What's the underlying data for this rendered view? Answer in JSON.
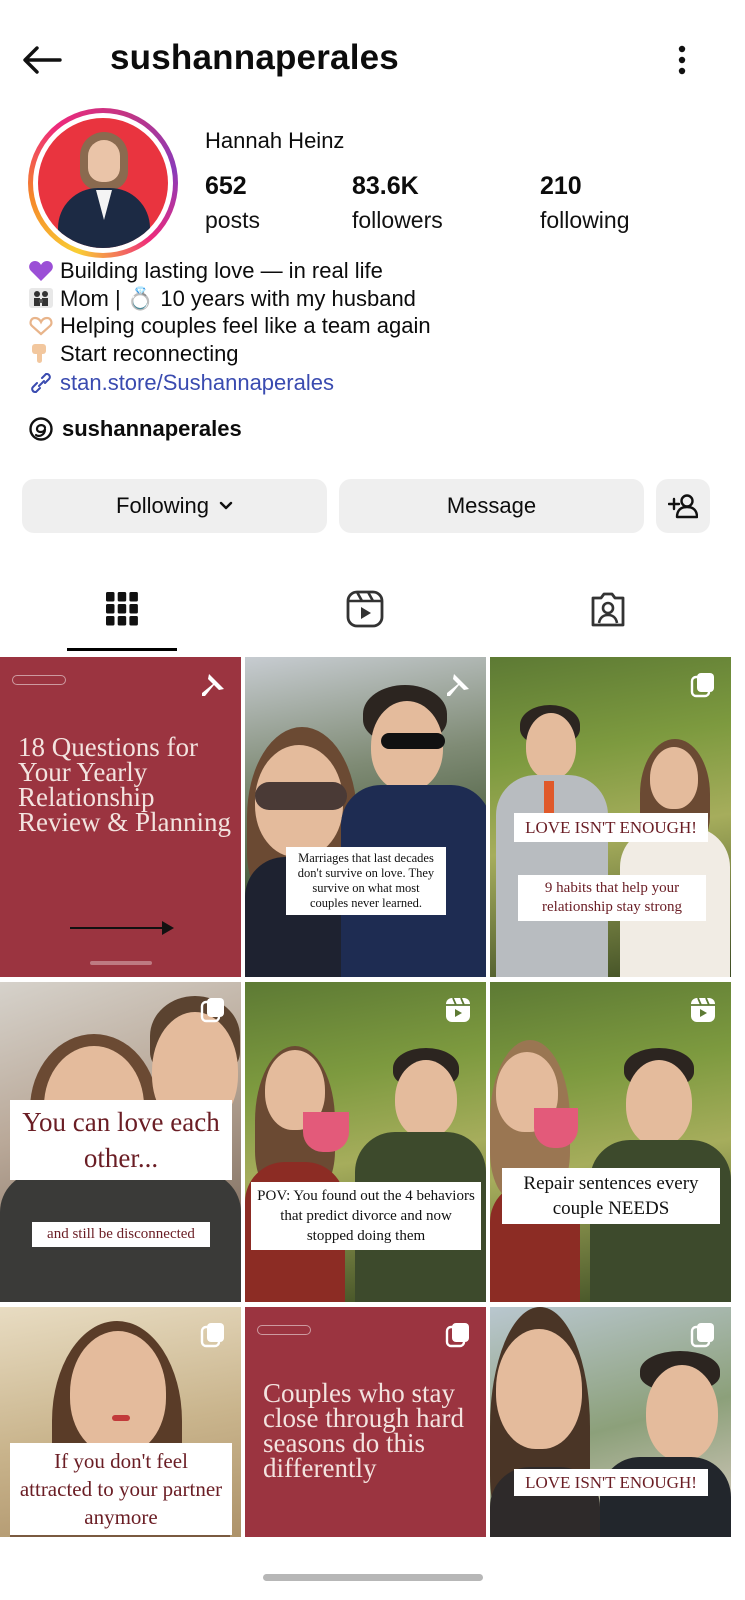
{
  "header": {
    "username": "sushannaperales",
    "back_icon": "arrow-left-icon",
    "more_icon": "more-vertical-icon"
  },
  "profile": {
    "display_name": "Hannah Heinz",
    "stats": {
      "posts_value": "652",
      "posts_label": "posts",
      "followers_value": "83.6K",
      "followers_label": "followers",
      "following_value": "210",
      "following_label": "following"
    },
    "bio_lines": [
      {
        "emoji": "purple-heart",
        "text": "Building lasting love — in real life"
      },
      {
        "emoji": "family",
        "text": "Mom | 💍 10 years with my husband"
      },
      {
        "emoji": "heart-hands",
        "text": "Helping couples feel like a team again"
      },
      {
        "emoji": "pointing-down",
        "text": "Start reconnecting"
      }
    ],
    "link": "stan.store/Sushannaperales",
    "threads_handle": "sushannaperales"
  },
  "actions": {
    "following_label": "Following",
    "message_label": "Message",
    "add_icon": "add-person-icon"
  },
  "tabs": [
    "grid",
    "reels",
    "tagged"
  ],
  "posts": [
    {
      "title": "18 Questions for Your Yearly Relationship Review & Planning",
      "type": "pinned"
    },
    {
      "caption": "Marriages that last decades don't survive on love. They survive on what most couples never learned.",
      "type": "pinned"
    },
    {
      "caption_top": "LOVE ISN'T ENOUGH!",
      "caption_bottom": "9 habits that help your relationship stay strong",
      "type": "carousel"
    },
    {
      "caption_top": "You can love each other...",
      "caption_bottom": "and still be disconnected",
      "type": "carousel"
    },
    {
      "caption": "POV: You found out the 4 behaviors that predict divorce and now stopped doing them",
      "type": "reel"
    },
    {
      "caption": "Repair sentences every couple NEEDS",
      "type": "reel"
    },
    {
      "caption": "If you don't feel attracted to your partner anymore",
      "type": "carousel"
    },
    {
      "title": "Couples who stay close through hard seasons do this differently",
      "type": "carousel"
    },
    {
      "caption": "LOVE ISN'T ENOUGH!",
      "type": "carousel"
    }
  ],
  "colors": {
    "link": "#3a4bb0",
    "button_bg": "#efefef",
    "maroon": "#9b3440"
  }
}
